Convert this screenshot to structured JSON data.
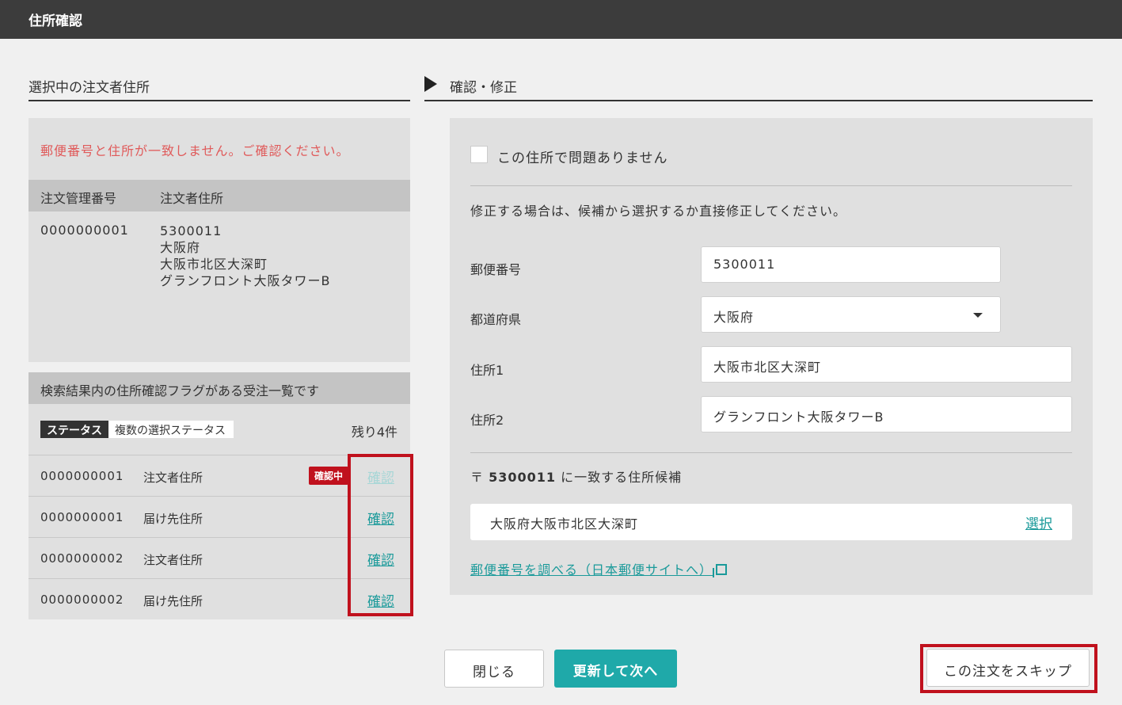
{
  "titlebar": {
    "title": "住所確認"
  },
  "left": {
    "section_title": "選択中の注文者住所",
    "warning": "郵便番号と住所が一致しません。ご確認ください。",
    "col_order_no": "注文管理番号",
    "col_address": "注文者住所",
    "order": {
      "no": "0000000001",
      "address_lines": [
        "5300011",
        "大阪府",
        "大阪市北区大深町",
        "グランフロント大阪タワーB"
      ]
    },
    "list": {
      "title": "検索結果内の住所確認フラグがある受注一覧です",
      "status_label": "ステータス",
      "status_value": "複数の選択ステータス",
      "remaining": "残り4件",
      "rows": [
        {
          "no": "0000000001",
          "type": "注文者住所",
          "badge": "確認中",
          "link": "確認"
        },
        {
          "no": "0000000001",
          "type": "届け先住所",
          "badge": "",
          "link": "確認"
        },
        {
          "no": "0000000002",
          "type": "注文者住所",
          "badge": "",
          "link": "確認"
        },
        {
          "no": "0000000002",
          "type": "届け先住所",
          "badge": "",
          "link": "確認"
        }
      ]
    }
  },
  "right": {
    "section_title": "確認・修正",
    "checkbox_label": "この住所で問題ありません",
    "note": "修正する場合は、候補から選択するか直接修正してください。",
    "fields": {
      "postal_label": "郵便番号",
      "postal_value": "5300011",
      "pref_label": "都道府県",
      "pref_value": "大阪府",
      "addr1_label": "住所1",
      "addr1_value": "大阪市北区大深町",
      "addr2_label": "住所2",
      "addr2_value": "グランフロント大阪タワーB"
    },
    "candidates": {
      "prefix": "〒",
      "postal": "5300011",
      "suffix": " に一致する住所候補",
      "items": [
        {
          "text": "大阪府大阪市北区大深町",
          "select": "選択"
        }
      ]
    },
    "postal_link": "郵便番号を調べる（日本郵便サイトへ）"
  },
  "footer": {
    "close": "閉じる",
    "next": "更新して次へ",
    "skip": "この注文をスキップ"
  },
  "colors": {
    "accent": "#1fa9a9",
    "alert": "#c0111d",
    "warning_text": "#e05a5a",
    "titlebar": "#3c3c3c"
  },
  "icons": {
    "section_marker": "triangle-right-icon",
    "external_link": "external-link-icon",
    "dropdown": "caret-down-icon"
  }
}
